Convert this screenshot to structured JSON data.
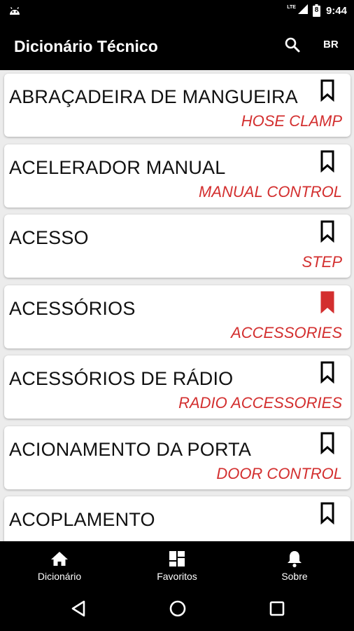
{
  "status_bar": {
    "network_label": "LTE",
    "battery_level": "8",
    "time": "9:44"
  },
  "app_bar": {
    "title": "Dicionário Técnico",
    "search_icon": "search-icon",
    "language_label": "BR"
  },
  "entries": [
    {
      "term": "ABRAÇADEIRA DE MANGUEIRA",
      "translation": "HOSE CLAMP",
      "bookmarked": false
    },
    {
      "term": "ACELERADOR MANUAL",
      "translation": "MANUAL CONTROL",
      "bookmarked": false
    },
    {
      "term": "ACESSO",
      "translation": "STEP",
      "bookmarked": false
    },
    {
      "term": "ACESSÓRIOS",
      "translation": "ACCESSORIES",
      "bookmarked": true
    },
    {
      "term": "ACESSÓRIOS DE RÁDIO",
      "translation": "RADIO ACCESSORIES",
      "bookmarked": false
    },
    {
      "term": "ACIONAMENTO DA PORTA",
      "translation": "DOOR CONTROL",
      "bookmarked": false
    },
    {
      "term": "ACOPLAMENTO",
      "translation": "",
      "bookmarked": false
    }
  ],
  "colors": {
    "translation": "#d32f2f",
    "bookmark_active": "#d32f2f",
    "bookmark_inactive": "#000000"
  },
  "bottom_nav": {
    "items": [
      {
        "label": "Dicionário",
        "icon": "home-icon",
        "active": true
      },
      {
        "label": "Favoritos",
        "icon": "grid-icon",
        "active": false
      },
      {
        "label": "Sobre",
        "icon": "bell-icon",
        "active": false
      }
    ]
  },
  "system_nav": {
    "back_icon": "back-triangle-icon",
    "home_icon": "home-circle-icon",
    "recents_icon": "recents-square-icon"
  }
}
